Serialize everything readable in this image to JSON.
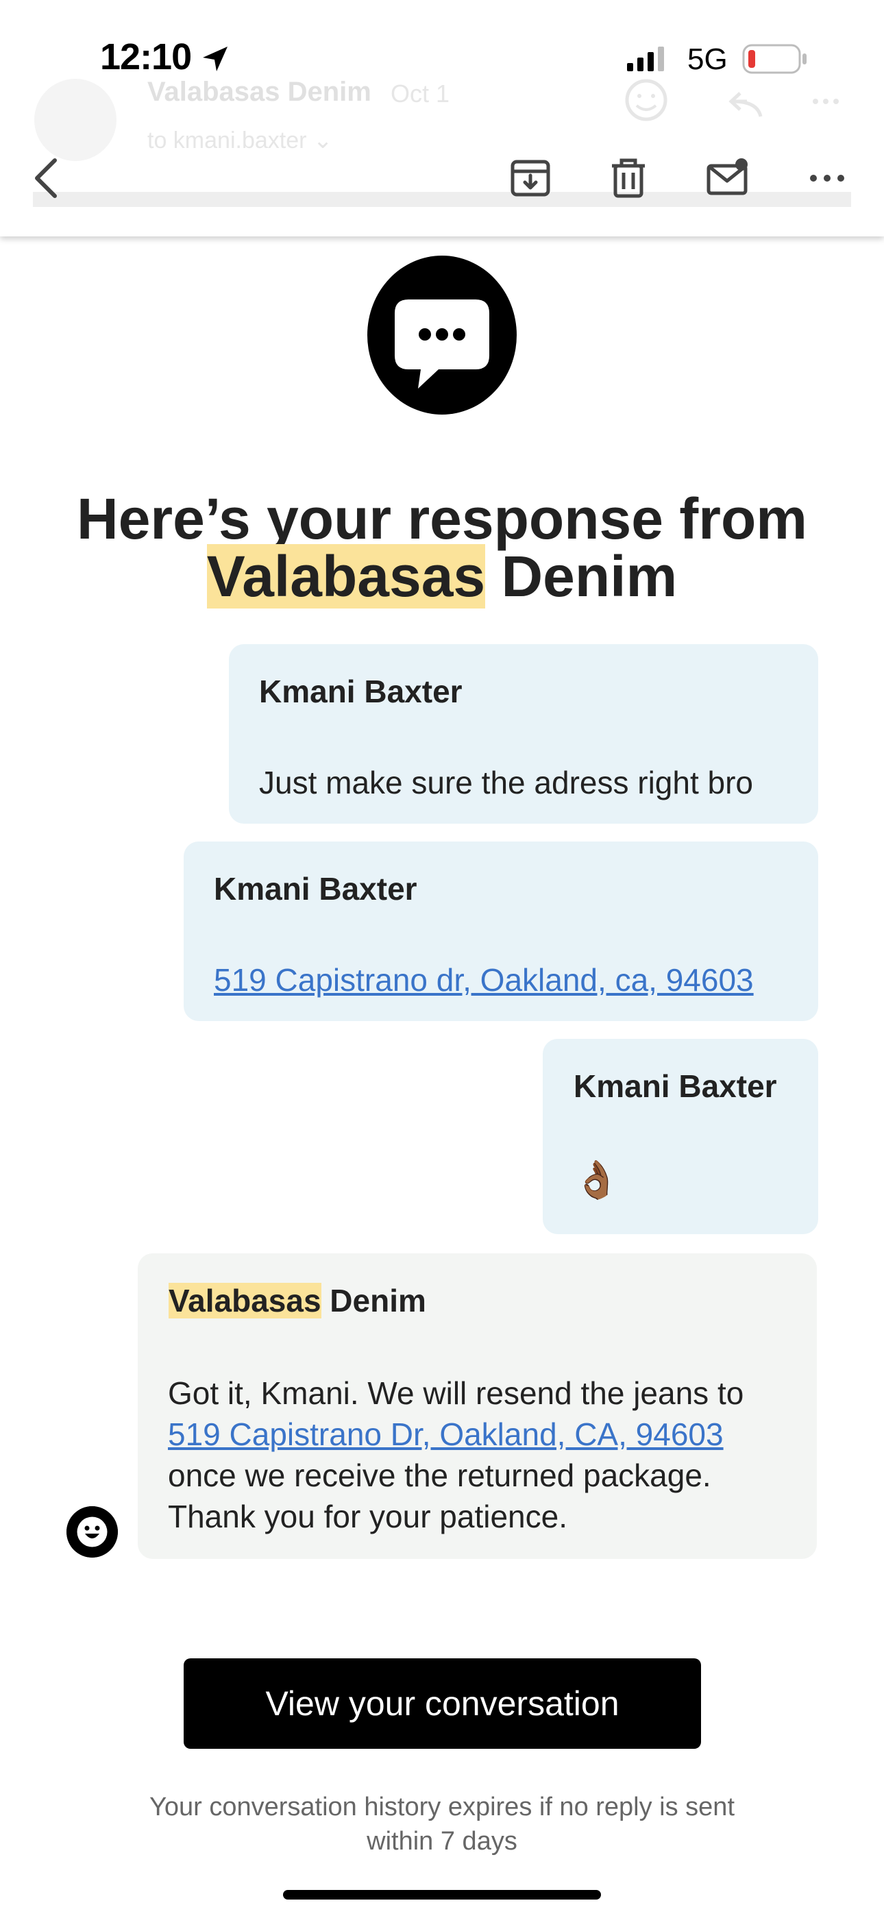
{
  "status_bar": {
    "time": "12:10",
    "network": "5G",
    "icons": [
      "location-arrow-icon",
      "signal-bars-icon",
      "battery-low-icon"
    ]
  },
  "background_email": {
    "sender": "Valabasas Denim",
    "date": "Oct 1",
    "recipient": "to kmani.baxter"
  },
  "toolbar": {
    "icons": [
      "back-chevron-icon",
      "archive-icon",
      "trash-icon",
      "mark-unread-icon",
      "more-icon"
    ]
  },
  "email": {
    "logo_icon": "chat-bubble-icon",
    "headline": {
      "line1": "Here’s your response from",
      "brand_highlight": "Valabasas",
      "brand_rest": " Denim"
    },
    "messages": [
      {
        "from": "Kmani Baxter",
        "text": "Just make sure the adress right bro"
      },
      {
        "from": "Kmani Baxter",
        "link": "519 Capistrano dr, Oakland, ca, 94603"
      },
      {
        "from": "Kmani Baxter",
        "emoji": "👌🏾"
      }
    ],
    "reply": {
      "from_highlight": "Valabasas",
      "from_rest": " Denim",
      "text_before": "Got it, Kmani. We will resend the jeans to ",
      "link": "519 Capistrano Dr, Oakland, CA, 94603",
      "text_after": " once we receive the returned package. Thank you for your patience.",
      "avatar_icon": "smiley-face-icon"
    },
    "cta_label": "View your conversation",
    "footnote": "Your conversation history expires if no reply is sent within 7 days"
  },
  "colors": {
    "user_bubble": "#e8f3f8",
    "agent_bubble": "#f3f5f3",
    "highlight": "#fbe39a",
    "link": "#3a74c9",
    "cta": "#000000"
  }
}
